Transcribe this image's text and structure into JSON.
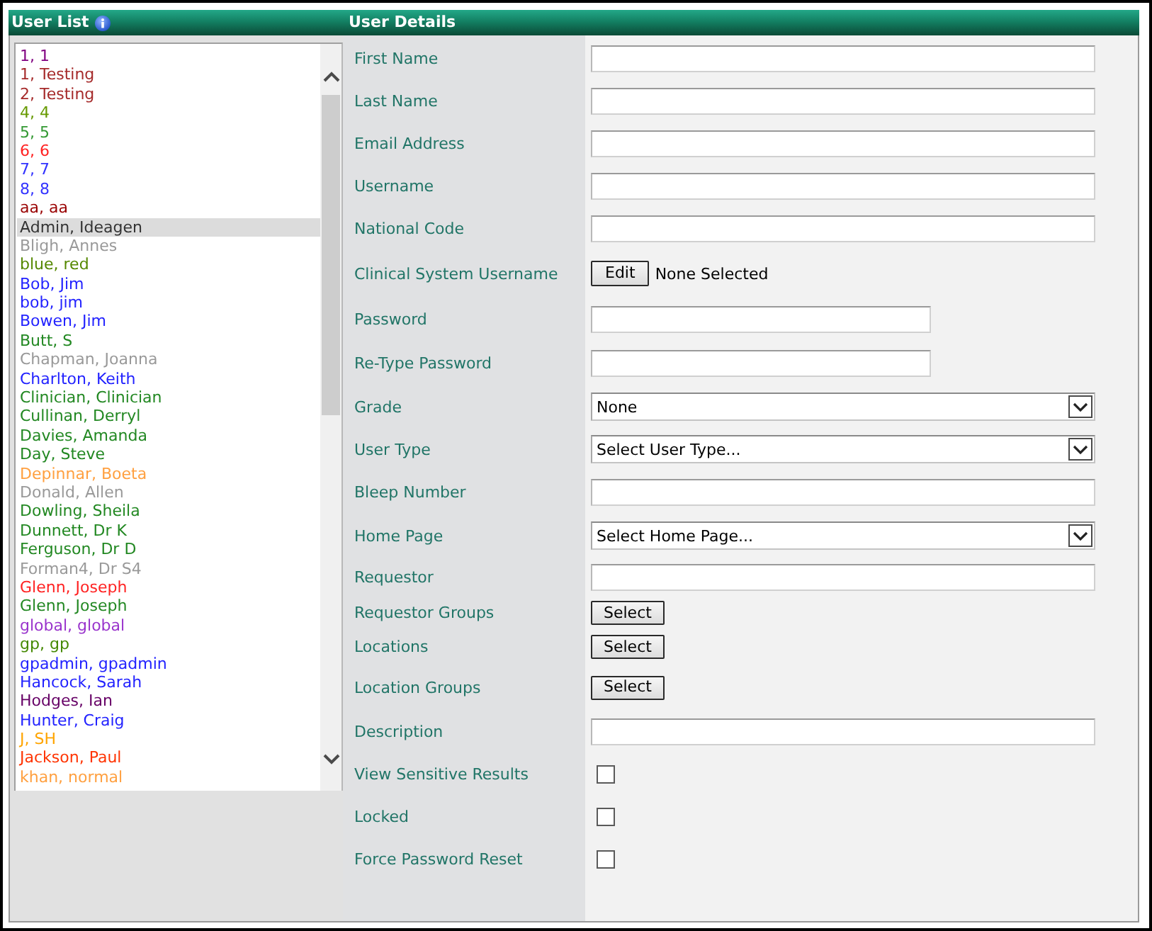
{
  "user_list": {
    "title": "User List",
    "items": [
      {
        "name": "1, 1",
        "color": "#800080",
        "selected": false
      },
      {
        "name": "1, Testing",
        "color": "#a52a2a",
        "selected": false
      },
      {
        "name": "2, Testing",
        "color": "#a52a2a",
        "selected": false
      },
      {
        "name": "4, 4",
        "color": "#669900",
        "selected": false
      },
      {
        "name": "5, 5",
        "color": "#339933",
        "selected": false
      },
      {
        "name": "6, 6",
        "color": "#ff2222",
        "selected": false
      },
      {
        "name": "7, 7",
        "color": "#3333ff",
        "selected": false
      },
      {
        "name": "8, 8",
        "color": "#3333ff",
        "selected": false
      },
      {
        "name": "aa, aa",
        "color": "#990000",
        "selected": false
      },
      {
        "name": "Admin, Ideagen",
        "color": "#333333",
        "selected": true
      },
      {
        "name": "Bligh, Annes",
        "color": "#999999",
        "selected": false
      },
      {
        "name": "blue, red",
        "color": "#558800",
        "selected": false
      },
      {
        "name": "Bob, Jim",
        "color": "#2222ff",
        "selected": false
      },
      {
        "name": "bob, jim",
        "color": "#2222ff",
        "selected": false
      },
      {
        "name": "Bowen, Jim",
        "color": "#2222ff",
        "selected": false
      },
      {
        "name": "Butt, S",
        "color": "#228822",
        "selected": false
      },
      {
        "name": "Chapman, Joanna",
        "color": "#999999",
        "selected": false
      },
      {
        "name": "Charlton, Keith",
        "color": "#2222ff",
        "selected": false
      },
      {
        "name": "Clinician, Clinician",
        "color": "#228822",
        "selected": false
      },
      {
        "name": "Cullinan, Derryl",
        "color": "#228822",
        "selected": false
      },
      {
        "name": "Davies, Amanda",
        "color": "#228822",
        "selected": false
      },
      {
        "name": "Day, Steve",
        "color": "#228822",
        "selected": false
      },
      {
        "name": "Depinnar, Boeta",
        "color": "#ffa040",
        "selected": false
      },
      {
        "name": "Donald, Allen",
        "color": "#999999",
        "selected": false
      },
      {
        "name": "Dowling, Sheila",
        "color": "#228822",
        "selected": false
      },
      {
        "name": "Dunnett, Dr K",
        "color": "#228822",
        "selected": false
      },
      {
        "name": "Ferguson, Dr D",
        "color": "#228822",
        "selected": false
      },
      {
        "name": "Forman4, Dr S4",
        "color": "#999999",
        "selected": false
      },
      {
        "name": "Glenn, Joseph",
        "color": "#ff2222",
        "selected": false
      },
      {
        "name": "Glenn, Joseph",
        "color": "#228822",
        "selected": false
      },
      {
        "name": "global, global",
        "color": "#9933cc",
        "selected": false
      },
      {
        "name": "gp, gp",
        "color": "#448800",
        "selected": false
      },
      {
        "name": "gpadmin, gpadmin",
        "color": "#2222ff",
        "selected": false
      },
      {
        "name": "Hancock, Sarah",
        "color": "#2222ff",
        "selected": false
      },
      {
        "name": "Hodges, Ian",
        "color": "#660066",
        "selected": false
      },
      {
        "name": "Hunter, Craig",
        "color": "#2222ff",
        "selected": false
      },
      {
        "name": "J, SH",
        "color": "#ffa500",
        "selected": false
      },
      {
        "name": "Jackson, Paul",
        "color": "#ff3300",
        "selected": false
      },
      {
        "name": "khan, normal",
        "color": "#ffa040",
        "selected": false
      }
    ]
  },
  "user_details": {
    "title": "User Details",
    "fields": [
      {
        "label": "First Name",
        "kind": "text"
      },
      {
        "label": "Last Name",
        "kind": "text"
      },
      {
        "label": "Email Address",
        "kind": "text"
      },
      {
        "label": "Username",
        "kind": "text"
      },
      {
        "label": "National Code",
        "kind": "text"
      },
      {
        "label": "Clinical System Username",
        "kind": "edit",
        "button": "Edit",
        "value": "None Selected"
      },
      {
        "label": "Password",
        "kind": "password"
      },
      {
        "label": "Re-Type Password",
        "kind": "password"
      },
      {
        "label": "Grade",
        "kind": "select",
        "value": "None"
      },
      {
        "label": "User Type",
        "kind": "select",
        "value": "Select User Type..."
      },
      {
        "label": "Bleep Number",
        "kind": "text"
      },
      {
        "label": "Home Page",
        "kind": "select",
        "value": "Select Home Page..."
      },
      {
        "label": "Requestor",
        "kind": "text"
      },
      {
        "label": "Requestor Groups",
        "kind": "button",
        "button": "Select"
      },
      {
        "label": "Locations",
        "kind": "button",
        "button": "Select"
      },
      {
        "label": "Location Groups",
        "kind": "button",
        "button": "Select"
      },
      {
        "label": "Description",
        "kind": "text"
      },
      {
        "label": "View Sensitive Results",
        "kind": "checkbox",
        "checked": false
      },
      {
        "label": "Locked",
        "kind": "checkbox",
        "checked": false
      },
      {
        "label": "Force Password Reset",
        "kind": "checkbox",
        "checked": false
      }
    ]
  }
}
